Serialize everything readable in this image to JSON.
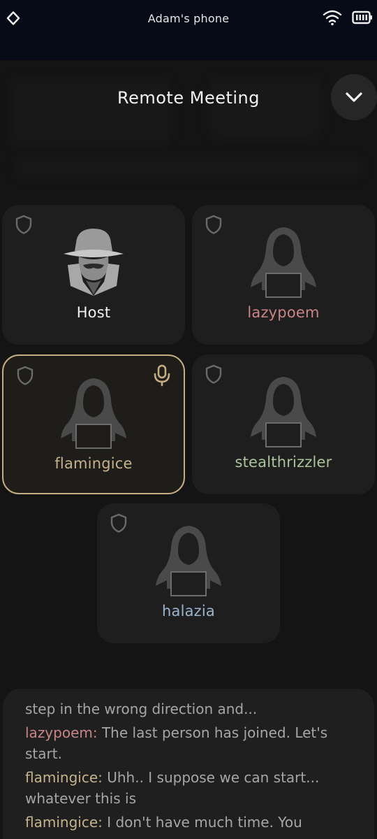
{
  "status_bar": {
    "device_name": "Adam's phone",
    "left_icon": "diamond-icon",
    "wifi_icon": "wifi-icon",
    "battery_icon": "battery-icon"
  },
  "header": {
    "title": "Remote Meeting",
    "collapse_icon": "chevron-down-icon"
  },
  "participants": [
    {
      "name": "Host",
      "color": "#f0f0f0",
      "avatar": "spy-hat-icon",
      "speaking": false
    },
    {
      "name": "lazypoem",
      "color": "#c98585",
      "avatar": "hooded-hacker-icon",
      "speaking": false
    },
    {
      "name": "flamingice",
      "color": "#c6b28b",
      "avatar": "hooded-hacker-icon",
      "speaking": true
    },
    {
      "name": "stealthrizzler",
      "color": "#a9c39b",
      "avatar": "hooded-hacker-icon",
      "speaking": false
    },
    {
      "name": "halazia",
      "color": "#9ab4cc",
      "avatar": "hooded-hacker-icon",
      "speaking": false
    }
  ],
  "chat": {
    "messages": [
      {
        "author": "",
        "text": "step in the wrong direction and...",
        "color": "#a6a6a6"
      },
      {
        "author": "lazypoem:",
        "text": " The last person has joined. Let's start.",
        "color": "#c98585"
      },
      {
        "author": "flamingice:",
        "text": " Uhh.. I suppose we can start... whatever this is",
        "color": "#c6b28b"
      },
      {
        "author": "flamingice:",
        "text": " I don't have much time. You",
        "color": "#c6b28b"
      }
    ]
  }
}
